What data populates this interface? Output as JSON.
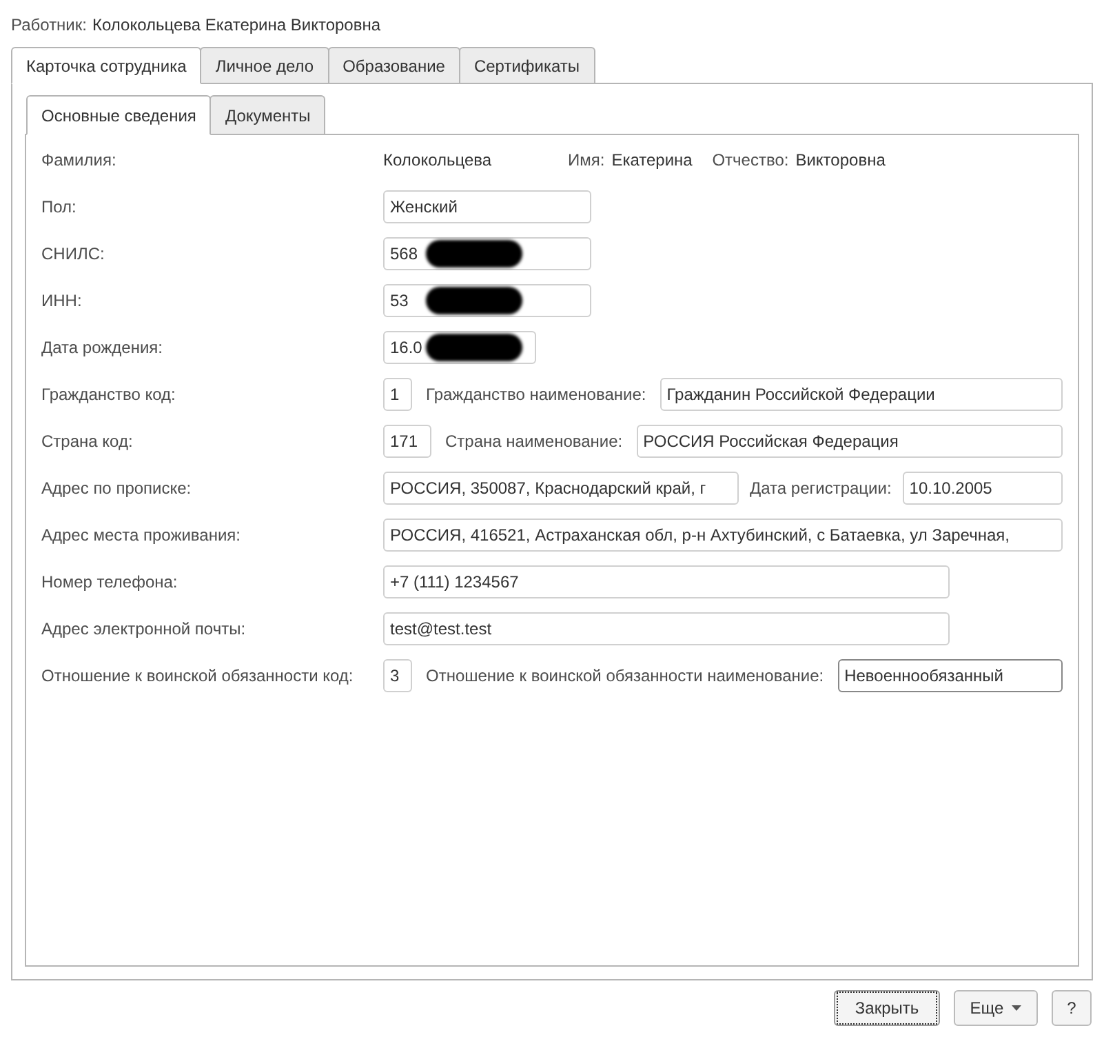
{
  "header": {
    "label": "Работник:",
    "value": "Колокольцева Екатерина Викторовна"
  },
  "tabs": [
    {
      "label": "Карточка сотрудника",
      "selected": true
    },
    {
      "label": "Личное дело",
      "selected": false
    },
    {
      "label": "Образование",
      "selected": false
    },
    {
      "label": "Сертификаты",
      "selected": false
    }
  ],
  "subtabs": [
    {
      "label": "Основные сведения",
      "selected": true
    },
    {
      "label": "Документы",
      "selected": false
    }
  ],
  "rows": [
    {
      "kind": "names",
      "label": "Фамилия:",
      "value": "Колокольцева",
      "first_name_label": "Имя:",
      "first_name": "Екатерина",
      "patronymic_label": "Отчество:",
      "patronymic": "Викторовна"
    },
    {
      "kind": "short",
      "label": "Пол:",
      "value": "Женский",
      "redacted": false
    },
    {
      "kind": "short",
      "label": "СНИЛС:",
      "value": "568",
      "redacted": true
    },
    {
      "kind": "short",
      "label": "ИНН:",
      "value": "53",
      "redacted": true
    },
    {
      "kind": "date",
      "label": "Дата рождения:",
      "value": "16.0",
      "redacted": true
    },
    {
      "kind": "code_name",
      "label": "Гражданство код:",
      "code": "1",
      "name_label": "Гражданство наименование:",
      "name": "Гражданин Российской Федерации"
    },
    {
      "kind": "code_name",
      "label": "Страна код:",
      "code": "171",
      "name_label": "Страна наименование:",
      "name": "РОССИЯ Российская Федерация"
    },
    {
      "kind": "address_date",
      "label": "Адрес по прописке:",
      "value": "РОССИЯ, 350087, Краснодарский край, г",
      "date_label": "Дата регистрации:",
      "date": "10.10.2005"
    },
    {
      "kind": "wide",
      "label": "Адрес места проживания:",
      "value": "РОССИЯ, 416521, Астраханская обл, р-н Ахтубинский, с Батаевка, ул Заречная,"
    },
    {
      "kind": "medium",
      "label": "Номер телефона:",
      "value": "+7 (111) 1234567"
    },
    {
      "kind": "medium",
      "label": "Адрес электронной почты:",
      "value": "test@test.test"
    },
    {
      "kind": "code_name",
      "label": "Отношение к воинской обязанности код:",
      "code": "3",
      "name_label": "Отношение к воинской обязанности наименование:",
      "name": "Невоеннообязанный",
      "focused": true
    }
  ],
  "buttons": [
    {
      "kind": "default",
      "label": "Закрыть"
    },
    {
      "kind": "menu",
      "label": "Еще"
    },
    {
      "kind": "plain",
      "label": "?"
    }
  ]
}
